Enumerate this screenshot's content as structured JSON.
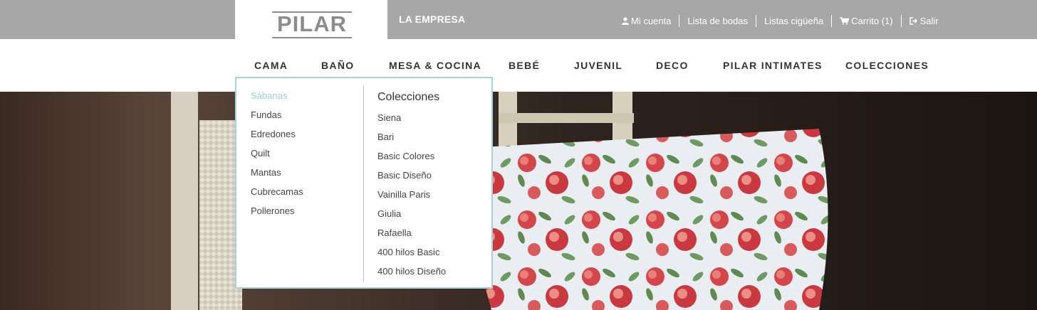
{
  "brand": {
    "logo_text": "PILAR"
  },
  "topbar": {
    "empresa_label": "LA EMPRESA",
    "util_links": [
      {
        "label": "Mi cuenta",
        "icon": "user-icon"
      },
      {
        "label": "Lista de bodas"
      },
      {
        "label": "Listas cigüeña"
      },
      {
        "label": "Carrito (1)",
        "icon": "cart-icon"
      },
      {
        "label": "Salir",
        "icon": "sign-out-icon"
      }
    ]
  },
  "nav": {
    "items": [
      "CAMA",
      "BAÑO",
      "MESA & COCINA",
      "BEBÉ",
      "JUVENIL",
      "DECO",
      "PILAR INTIMATES",
      "COLECCIONES"
    ]
  },
  "dropdown": {
    "left_links": [
      "Sábanas",
      "Fundas",
      "Edredones",
      "Quilt",
      "Mantas",
      "Cubrecamas",
      "Pollerones"
    ],
    "active_link": "Sábanas",
    "right_heading": "Colecciones",
    "right_links": [
      "Siena",
      "Bari",
      "Basic Colores",
      "Basic Diseño",
      "Vainilla Paris",
      "Giulia",
      "Rafaella",
      "400 hilos Basic",
      "400 hilos Diseño"
    ]
  },
  "colors": {
    "topbar_bg": "#a7a7a7",
    "accent": "#9fcfd6",
    "dropdown_border": "#a9d3d9"
  }
}
